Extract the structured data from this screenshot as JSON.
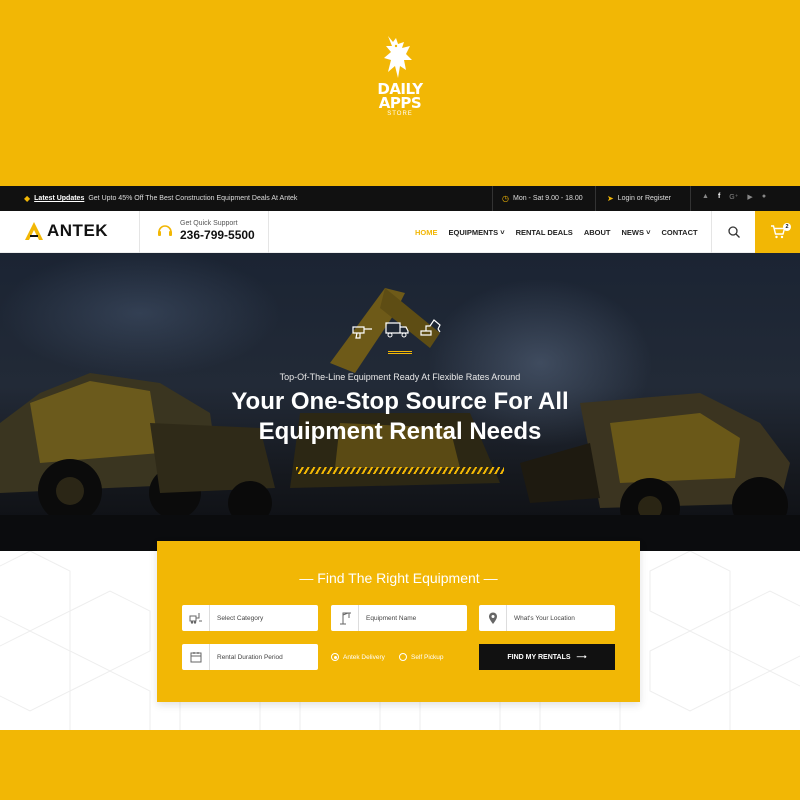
{
  "promo": {
    "brand_line1": "DAILY",
    "brand_line2": "APPS",
    "brand_line3": "STORE"
  },
  "topbar": {
    "updates_label": "Latest Updates",
    "updates_text": "Get Upto 45% Off The Best Construction Equipment Deals At Antek",
    "hours": "Mon - Sat  9.00 - 18.00",
    "login": "Login or Register"
  },
  "nav": {
    "logo": "ANTEK",
    "support_label": "Get Quick Support",
    "support_phone": "236-799-5500",
    "menu": [
      "HOME",
      "EQUIPMENTS",
      "RENTAL DEALS",
      "ABOUT",
      "NEWS",
      "CONTACT"
    ],
    "cart_count": "2"
  },
  "hero": {
    "eyebrow": "Top-Of-The-Line Equipment Ready At Flexible Rates Around",
    "headline_line1": "Your One-Stop Source For All",
    "headline_line2": "Equipment Rental Needs"
  },
  "finder": {
    "title": "Find The Right Equipment",
    "category": "Select Category",
    "equipment_name": "Equipment Name",
    "location": "What's Your Location",
    "duration": "Rental Duration Period",
    "option_delivery": "Antek Delivery",
    "option_pickup": "Self Pickup",
    "submit": "FIND MY RENTALS"
  },
  "colors": {
    "accent": "#f2b705",
    "dark": "#111111"
  }
}
